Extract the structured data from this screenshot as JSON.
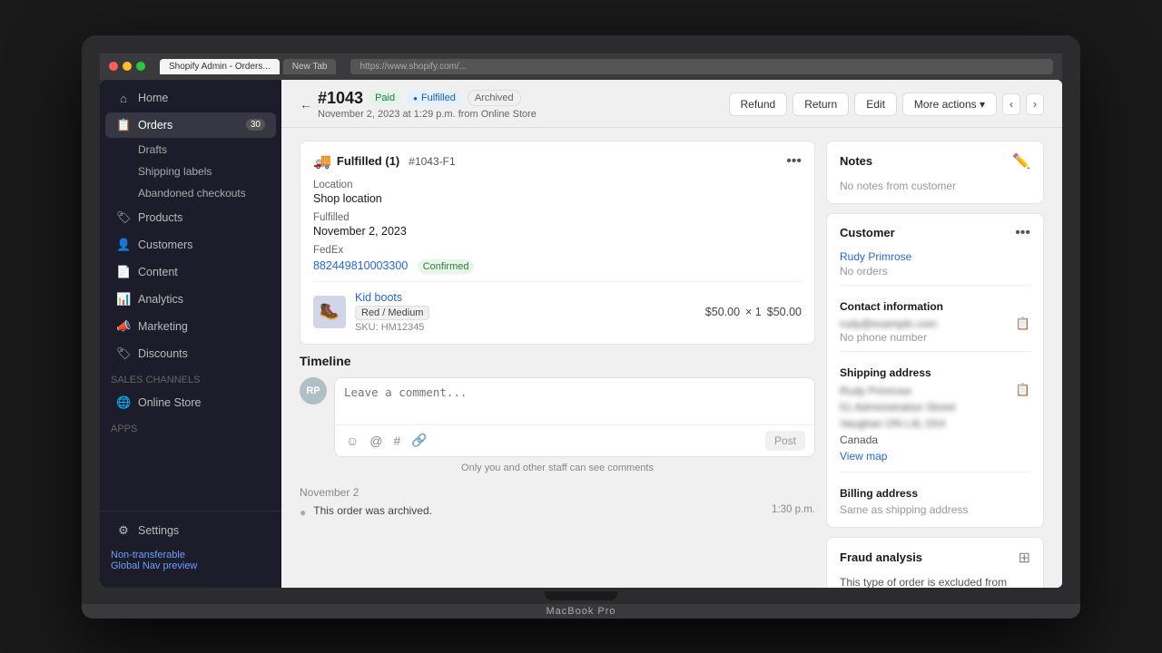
{
  "browser": {
    "tabs": [
      {
        "label": "Shopify Admin - Orders...",
        "active": true
      },
      {
        "label": "New Tab",
        "active": false
      }
    ],
    "address": "https://www.shopify.com/..."
  },
  "sidebar": {
    "home_label": "Home",
    "orders_label": "Orders",
    "orders_badge": "30",
    "orders_sub": [
      "Drafts",
      "Shipping labels",
      "Abandoned checkouts"
    ],
    "products_label": "Products",
    "customers_label": "Customers",
    "content_label": "Content",
    "analytics_label": "Analytics",
    "marketing_label": "Marketing",
    "discounts_label": "Discounts",
    "sales_channels_label": "Sales channels",
    "online_store_label": "Online Store",
    "apps_label": "Apps",
    "settings_label": "Settings",
    "nontransferable_label": "Non-transferable",
    "global_nav_label": "Global Nav preview"
  },
  "page_header": {
    "back_arrow": "←",
    "order_number": "#1043",
    "badge_paid": "Paid",
    "badge_fulfilled": "Fulfilled",
    "badge_archived": "Archived",
    "subtitle": "November 2, 2023 at 1:29 p.m. from Online Store",
    "btn_refund": "Refund",
    "btn_return": "Return",
    "btn_edit": "Edit",
    "btn_more": "More actions",
    "nav_prev": "‹",
    "nav_next": "›"
  },
  "fulfillment_card": {
    "icon": "🚚",
    "title": "Fulfilled (1)",
    "order_id": "#1043-F1",
    "location_label": "Location",
    "location_value": "Shop location",
    "fulfilled_label": "Fulfilled",
    "fulfilled_date": "November 2, 2023",
    "carrier_label": "FedEx",
    "tracking_number": "882449810003300",
    "tracking_status": "Confirmed",
    "product_name": "Kid boots",
    "product_variant": "Red / Medium",
    "product_sku": "SKU: HM12345",
    "product_price": "$50.00",
    "product_qty": "× 1",
    "product_total": "$50.00"
  },
  "timeline": {
    "title": "Timeline",
    "comment_placeholder": "Leave a comment...",
    "avatar_initials": "RP",
    "post_btn": "Post",
    "staff_note": "Only you and other staff can see comments",
    "date_label": "November 2",
    "event_text": "This order was archived.",
    "event_time": "1:30 p.m."
  },
  "notes_card": {
    "title": "Notes",
    "no_notes": "No notes from customer"
  },
  "customer_card": {
    "title": "Customer",
    "customer_name": "Rudy Primrose",
    "no_orders": "No orders",
    "contact_label": "Contact information",
    "email": "rudy@example.com",
    "no_phone": "No phone number",
    "shipping_label": "Shipping address",
    "shipping_name": "Rudy Primrose",
    "shipping_street": "51 Administration Street",
    "shipping_city": "Vaughan ON L4L 0X4",
    "shipping_country": "Canada",
    "view_map": "View map",
    "billing_label": "Billing address",
    "billing_same": "Same as shipping address"
  },
  "fraud_card": {
    "title": "Fraud analysis",
    "text": "This type of order is excluded from credit card fraud analysis."
  }
}
